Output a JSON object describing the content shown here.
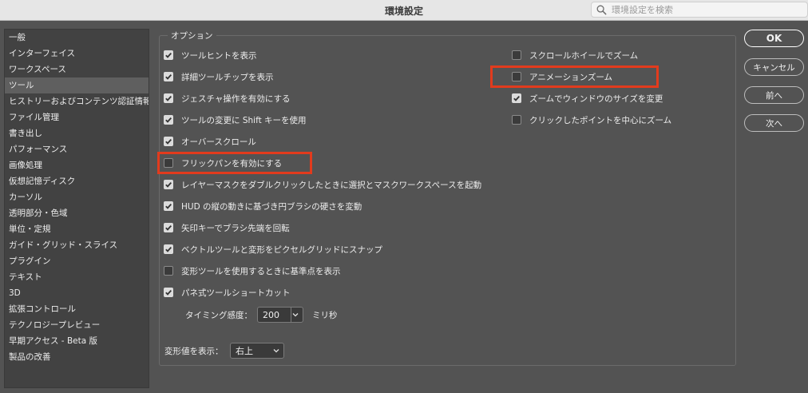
{
  "window": {
    "title": "環境設定"
  },
  "search": {
    "placeholder": "環境設定を検索"
  },
  "sidebar": {
    "items": [
      {
        "label": "一般"
      },
      {
        "label": "インターフェイス"
      },
      {
        "label": "ワークスペース"
      },
      {
        "label": "ツール"
      },
      {
        "label": "ヒストリーおよびコンテンツ認証情報"
      },
      {
        "label": "ファイル管理"
      },
      {
        "label": "書き出し"
      },
      {
        "label": "パフォーマンス"
      },
      {
        "label": "画像処理"
      },
      {
        "label": "仮想記憶ディスク"
      },
      {
        "label": "カーソル"
      },
      {
        "label": "透明部分・色域"
      },
      {
        "label": "単位・定規"
      },
      {
        "label": "ガイド・グリッド・スライス"
      },
      {
        "label": "プラグイン"
      },
      {
        "label": "テキスト"
      },
      {
        "label": "3D"
      },
      {
        "label": "拡張コントロール"
      },
      {
        "label": "テクノロジープレビュー"
      },
      {
        "label": "早期アクセス - Beta 版"
      },
      {
        "label": "製品の改善"
      }
    ],
    "selected": "ツール"
  },
  "options": {
    "legend": "オプション",
    "left": [
      {
        "label": "ツールヒントを表示",
        "checked": true
      },
      {
        "label": "詳細ツールチップを表示",
        "checked": true
      },
      {
        "label": "ジェスチャ操作を有効にする",
        "checked": true
      },
      {
        "label": "ツールの変更に Shift キーを使用",
        "checked": true
      },
      {
        "label": "オーバースクロール",
        "checked": true
      },
      {
        "label": "フリックパンを有効にする",
        "checked": false
      },
      {
        "label": "レイヤーマスクをダブルクリックしたときに選択とマスクワークスペースを起動",
        "checked": true
      },
      {
        "label": "HUD の縦の動きに基づき円ブラシの硬さを変動",
        "checked": true
      },
      {
        "label": "矢印キーでブラシ先端を回転",
        "checked": true
      },
      {
        "label": "ベクトルツールと変形をピクセルグリッドにスナップ",
        "checked": true
      },
      {
        "label": "変形ツールを使用するときに基準点を表示",
        "checked": false
      },
      {
        "label": "パネ式ツールショートカット",
        "checked": true
      }
    ],
    "right": [
      {
        "label": "スクロールホイールでズーム",
        "checked": false
      },
      {
        "label": "アニメーションズーム",
        "checked": false
      },
      {
        "label": "ズームでウィンドウのサイズを変更",
        "checked": true
      },
      {
        "label": "クリックしたポイントを中心にズーム",
        "checked": false
      }
    ],
    "timing": {
      "label": "タイミング感度：",
      "value": "200",
      "unit": "ミリ秒"
    },
    "transform": {
      "label": "変形値を表示：",
      "value": "右上"
    }
  },
  "buttons": {
    "ok": "OK",
    "cancel": "キャンセル",
    "prev": "前へ",
    "next": "次へ"
  },
  "colors": {
    "highlight": "#e23b1d",
    "background": "#535353"
  }
}
